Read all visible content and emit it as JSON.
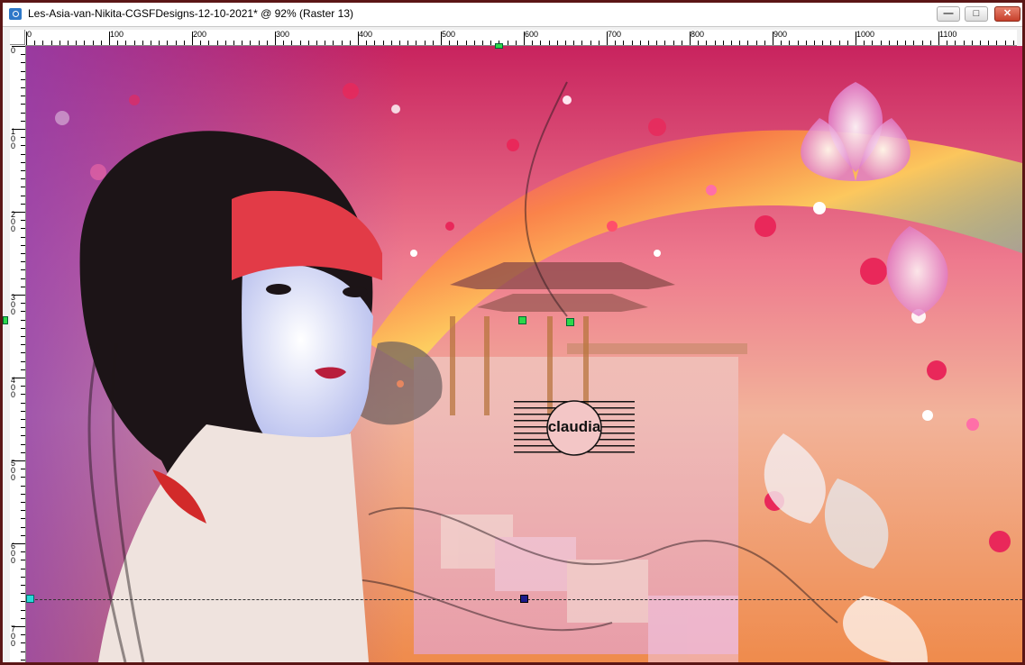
{
  "window": {
    "title": "Les-Asia-van-Nikita-CGSFDesigns-12-10-2021* @  92% (Raster 13)",
    "frame_color": "#5b1616"
  },
  "title_buttons": {
    "minimize_glyph": "—",
    "maximize_glyph": "□",
    "close_glyph": "✕"
  },
  "ruler": {
    "horizontal_labels": [
      "0",
      "100",
      "200",
      "300",
      "400",
      "500",
      "600",
      "700",
      "800",
      "900",
      "1000",
      "1100"
    ],
    "vertical_labels": [
      "0",
      "100",
      "200",
      "300",
      "400",
      "500",
      "600",
      "700"
    ]
  },
  "canvas": {
    "watermark_text": "claudia",
    "colors": {
      "sky_top": "#d8356e",
      "sky_mid": "#f3a37a",
      "rainbow_yellow": "#ffd35a",
      "water": "#e9b3b0",
      "floor": "#ef8b4c",
      "hair": "#1c1417",
      "bangs": "#e23b47",
      "skin": "#e9ecff",
      "flower": "#f4c9e6",
      "bokeh": "#e9285a"
    }
  },
  "icons": {
    "app": "psp-image-icon",
    "minimize": "minimize-icon",
    "maximize": "maximize-icon",
    "close": "close-icon"
  }
}
